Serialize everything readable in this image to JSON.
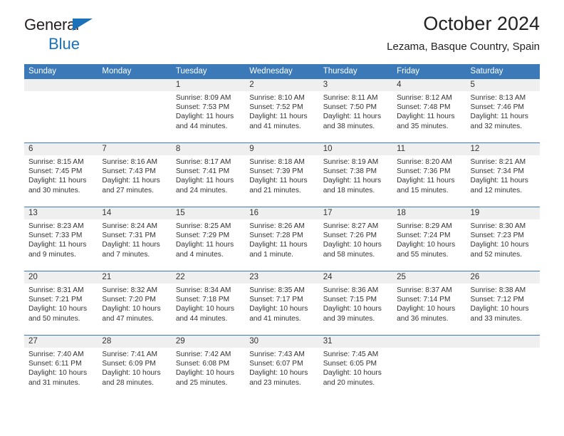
{
  "brand": {
    "line1": "General",
    "line2": "Blue",
    "logo_icon": "triangle-icon",
    "accent_color": "#1b72b8"
  },
  "header": {
    "title": "October 2024",
    "subtitle": "Lezama, Basque Country, Spain"
  },
  "colors": {
    "header_blue": "#3b79b8",
    "daynum_band": "#efefef",
    "text": "#333333"
  },
  "weekdays": [
    "Sunday",
    "Monday",
    "Tuesday",
    "Wednesday",
    "Thursday",
    "Friday",
    "Saturday"
  ],
  "weeks": [
    [
      {
        "day": ""
      },
      {
        "day": ""
      },
      {
        "day": "1",
        "sunrise": "Sunrise: 8:09 AM",
        "sunset": "Sunset: 7:53 PM",
        "daylight1": "Daylight: 11 hours",
        "daylight2": "and 44 minutes."
      },
      {
        "day": "2",
        "sunrise": "Sunrise: 8:10 AM",
        "sunset": "Sunset: 7:52 PM",
        "daylight1": "Daylight: 11 hours",
        "daylight2": "and 41 minutes."
      },
      {
        "day": "3",
        "sunrise": "Sunrise: 8:11 AM",
        "sunset": "Sunset: 7:50 PM",
        "daylight1": "Daylight: 11 hours",
        "daylight2": "and 38 minutes."
      },
      {
        "day": "4",
        "sunrise": "Sunrise: 8:12 AM",
        "sunset": "Sunset: 7:48 PM",
        "daylight1": "Daylight: 11 hours",
        "daylight2": "and 35 minutes."
      },
      {
        "day": "5",
        "sunrise": "Sunrise: 8:13 AM",
        "sunset": "Sunset: 7:46 PM",
        "daylight1": "Daylight: 11 hours",
        "daylight2": "and 32 minutes."
      }
    ],
    [
      {
        "day": "6",
        "sunrise": "Sunrise: 8:15 AM",
        "sunset": "Sunset: 7:45 PM",
        "daylight1": "Daylight: 11 hours",
        "daylight2": "and 30 minutes."
      },
      {
        "day": "7",
        "sunrise": "Sunrise: 8:16 AM",
        "sunset": "Sunset: 7:43 PM",
        "daylight1": "Daylight: 11 hours",
        "daylight2": "and 27 minutes."
      },
      {
        "day": "8",
        "sunrise": "Sunrise: 8:17 AM",
        "sunset": "Sunset: 7:41 PM",
        "daylight1": "Daylight: 11 hours",
        "daylight2": "and 24 minutes."
      },
      {
        "day": "9",
        "sunrise": "Sunrise: 8:18 AM",
        "sunset": "Sunset: 7:39 PM",
        "daylight1": "Daylight: 11 hours",
        "daylight2": "and 21 minutes."
      },
      {
        "day": "10",
        "sunrise": "Sunrise: 8:19 AM",
        "sunset": "Sunset: 7:38 PM",
        "daylight1": "Daylight: 11 hours",
        "daylight2": "and 18 minutes."
      },
      {
        "day": "11",
        "sunrise": "Sunrise: 8:20 AM",
        "sunset": "Sunset: 7:36 PM",
        "daylight1": "Daylight: 11 hours",
        "daylight2": "and 15 minutes."
      },
      {
        "day": "12",
        "sunrise": "Sunrise: 8:21 AM",
        "sunset": "Sunset: 7:34 PM",
        "daylight1": "Daylight: 11 hours",
        "daylight2": "and 12 minutes."
      }
    ],
    [
      {
        "day": "13",
        "sunrise": "Sunrise: 8:23 AM",
        "sunset": "Sunset: 7:33 PM",
        "daylight1": "Daylight: 11 hours",
        "daylight2": "and 9 minutes."
      },
      {
        "day": "14",
        "sunrise": "Sunrise: 8:24 AM",
        "sunset": "Sunset: 7:31 PM",
        "daylight1": "Daylight: 11 hours",
        "daylight2": "and 7 minutes."
      },
      {
        "day": "15",
        "sunrise": "Sunrise: 8:25 AM",
        "sunset": "Sunset: 7:29 PM",
        "daylight1": "Daylight: 11 hours",
        "daylight2": "and 4 minutes."
      },
      {
        "day": "16",
        "sunrise": "Sunrise: 8:26 AM",
        "sunset": "Sunset: 7:28 PM",
        "daylight1": "Daylight: 11 hours",
        "daylight2": "and 1 minute."
      },
      {
        "day": "17",
        "sunrise": "Sunrise: 8:27 AM",
        "sunset": "Sunset: 7:26 PM",
        "daylight1": "Daylight: 10 hours",
        "daylight2": "and 58 minutes."
      },
      {
        "day": "18",
        "sunrise": "Sunrise: 8:29 AM",
        "sunset": "Sunset: 7:24 PM",
        "daylight1": "Daylight: 10 hours",
        "daylight2": "and 55 minutes."
      },
      {
        "day": "19",
        "sunrise": "Sunrise: 8:30 AM",
        "sunset": "Sunset: 7:23 PM",
        "daylight1": "Daylight: 10 hours",
        "daylight2": "and 52 minutes."
      }
    ],
    [
      {
        "day": "20",
        "sunrise": "Sunrise: 8:31 AM",
        "sunset": "Sunset: 7:21 PM",
        "daylight1": "Daylight: 10 hours",
        "daylight2": "and 50 minutes."
      },
      {
        "day": "21",
        "sunrise": "Sunrise: 8:32 AM",
        "sunset": "Sunset: 7:20 PM",
        "daylight1": "Daylight: 10 hours",
        "daylight2": "and 47 minutes."
      },
      {
        "day": "22",
        "sunrise": "Sunrise: 8:34 AM",
        "sunset": "Sunset: 7:18 PM",
        "daylight1": "Daylight: 10 hours",
        "daylight2": "and 44 minutes."
      },
      {
        "day": "23",
        "sunrise": "Sunrise: 8:35 AM",
        "sunset": "Sunset: 7:17 PM",
        "daylight1": "Daylight: 10 hours",
        "daylight2": "and 41 minutes."
      },
      {
        "day": "24",
        "sunrise": "Sunrise: 8:36 AM",
        "sunset": "Sunset: 7:15 PM",
        "daylight1": "Daylight: 10 hours",
        "daylight2": "and 39 minutes."
      },
      {
        "day": "25",
        "sunrise": "Sunrise: 8:37 AM",
        "sunset": "Sunset: 7:14 PM",
        "daylight1": "Daylight: 10 hours",
        "daylight2": "and 36 minutes."
      },
      {
        "day": "26",
        "sunrise": "Sunrise: 8:38 AM",
        "sunset": "Sunset: 7:12 PM",
        "daylight1": "Daylight: 10 hours",
        "daylight2": "and 33 minutes."
      }
    ],
    [
      {
        "day": "27",
        "sunrise": "Sunrise: 7:40 AM",
        "sunset": "Sunset: 6:11 PM",
        "daylight1": "Daylight: 10 hours",
        "daylight2": "and 31 minutes."
      },
      {
        "day": "28",
        "sunrise": "Sunrise: 7:41 AM",
        "sunset": "Sunset: 6:09 PM",
        "daylight1": "Daylight: 10 hours",
        "daylight2": "and 28 minutes."
      },
      {
        "day": "29",
        "sunrise": "Sunrise: 7:42 AM",
        "sunset": "Sunset: 6:08 PM",
        "daylight1": "Daylight: 10 hours",
        "daylight2": "and 25 minutes."
      },
      {
        "day": "30",
        "sunrise": "Sunrise: 7:43 AM",
        "sunset": "Sunset: 6:07 PM",
        "daylight1": "Daylight: 10 hours",
        "daylight2": "and 23 minutes."
      },
      {
        "day": "31",
        "sunrise": "Sunrise: 7:45 AM",
        "sunset": "Sunset: 6:05 PM",
        "daylight1": "Daylight: 10 hours",
        "daylight2": "and 20 minutes."
      },
      {
        "day": ""
      },
      {
        "day": ""
      }
    ]
  ]
}
